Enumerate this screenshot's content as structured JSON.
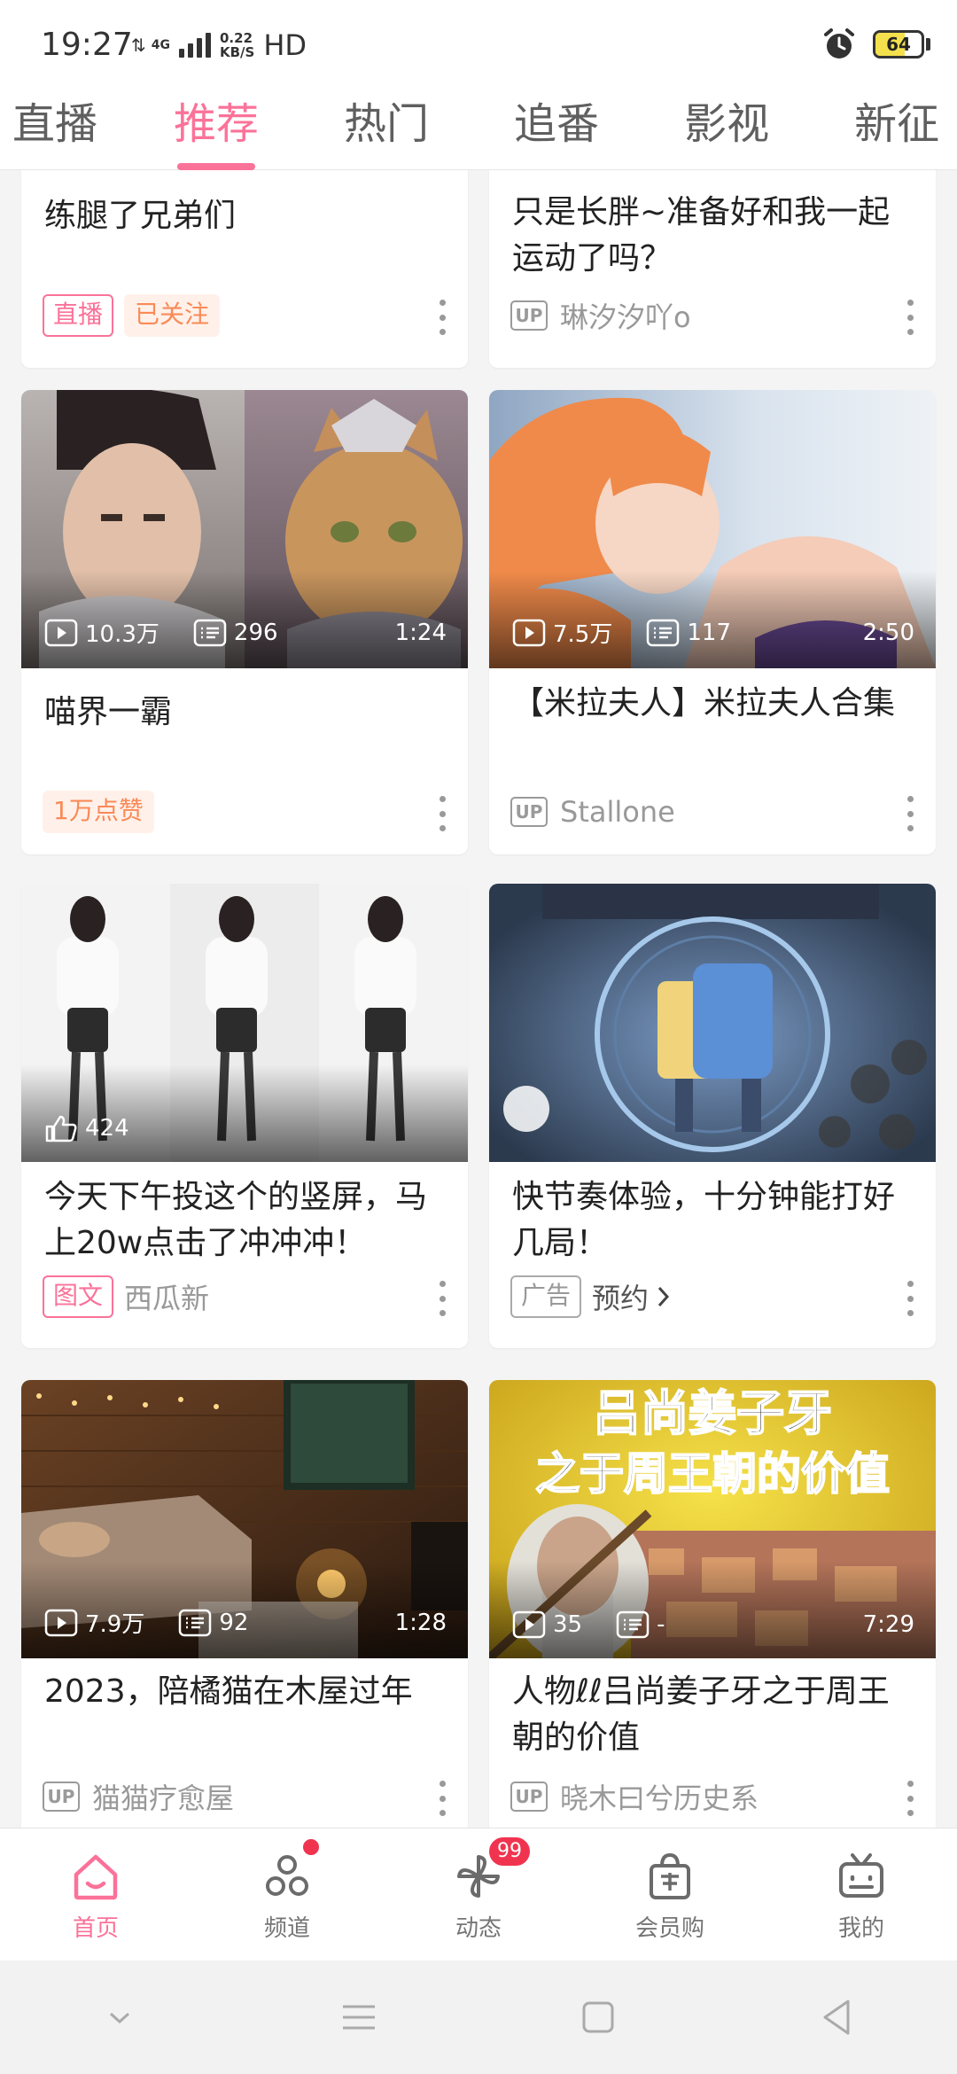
{
  "status_bar": {
    "time": "19:27",
    "network": "4G",
    "speed_value": "0.22",
    "speed_unit": "KB/S",
    "hd": "HD",
    "battery_level": 64
  },
  "top_tabs": [
    {
      "label": "直播",
      "active": false
    },
    {
      "label": "推荐",
      "active": true
    },
    {
      "label": "热门",
      "active": false
    },
    {
      "label": "追番",
      "active": false
    },
    {
      "label": "影视",
      "active": false
    },
    {
      "label": "新征",
      "active": false
    }
  ],
  "feed": {
    "cards": [
      {
        "title": "练腿了兄弟们",
        "tags": [
          "直播",
          "已关注"
        ]
      },
      {
        "title": "只是长胖~准备好和我一起运动了吗？",
        "author": "琳汐汐吖o",
        "up_badge": "UP"
      },
      {
        "title": "喵界一霸",
        "views": "10.3万",
        "comments": "296",
        "duration": "1:24",
        "tags": [
          "1万点赞"
        ]
      },
      {
        "title": "【米拉夫人】米拉夫人合集",
        "views": "7.5万",
        "comments": "117",
        "duration": "2:50",
        "author": "Stallone",
        "up_badge": "UP"
      },
      {
        "title": "今天下午投这个的竖屏，马上20w点击了冲冲冲！",
        "likes": "424",
        "tags": [
          "图文"
        ],
        "author": "西瓜新"
      },
      {
        "title": "快节奏体验，十分钟能打好几局！",
        "tags": [
          "广告"
        ],
        "ad_action": "预约"
      },
      {
        "title": "2023，陪橘猫在木屋过年",
        "views": "7.9万",
        "comments": "92",
        "duration": "1:28",
        "author": "猫猫疗愈屋",
        "up_badge": "UP"
      },
      {
        "title": "人物ℓℓ吕尚姜子牙之于周王朝的价值",
        "views": "35",
        "comments": "-",
        "duration": "7:29",
        "author": "晓木曰兮历史系",
        "up_badge": "UP",
        "thumb_text_1": "吕尚姜子牙",
        "thumb_text_2": "之于周王朝的价值"
      }
    ]
  },
  "bottom_nav": [
    {
      "label": "首页",
      "icon": "home-icon",
      "active": true
    },
    {
      "label": "频道",
      "icon": "channel-icon",
      "dot": true
    },
    {
      "label": "动态",
      "icon": "pinwheel-icon",
      "badge": "99"
    },
    {
      "label": "会员购",
      "icon": "shopping-bag-icon"
    },
    {
      "label": "我的",
      "icon": "tv-icon"
    }
  ],
  "colors": {
    "accent": "#fb7299",
    "badge": "#f0344f",
    "orange_tag": "#fa8a57"
  }
}
